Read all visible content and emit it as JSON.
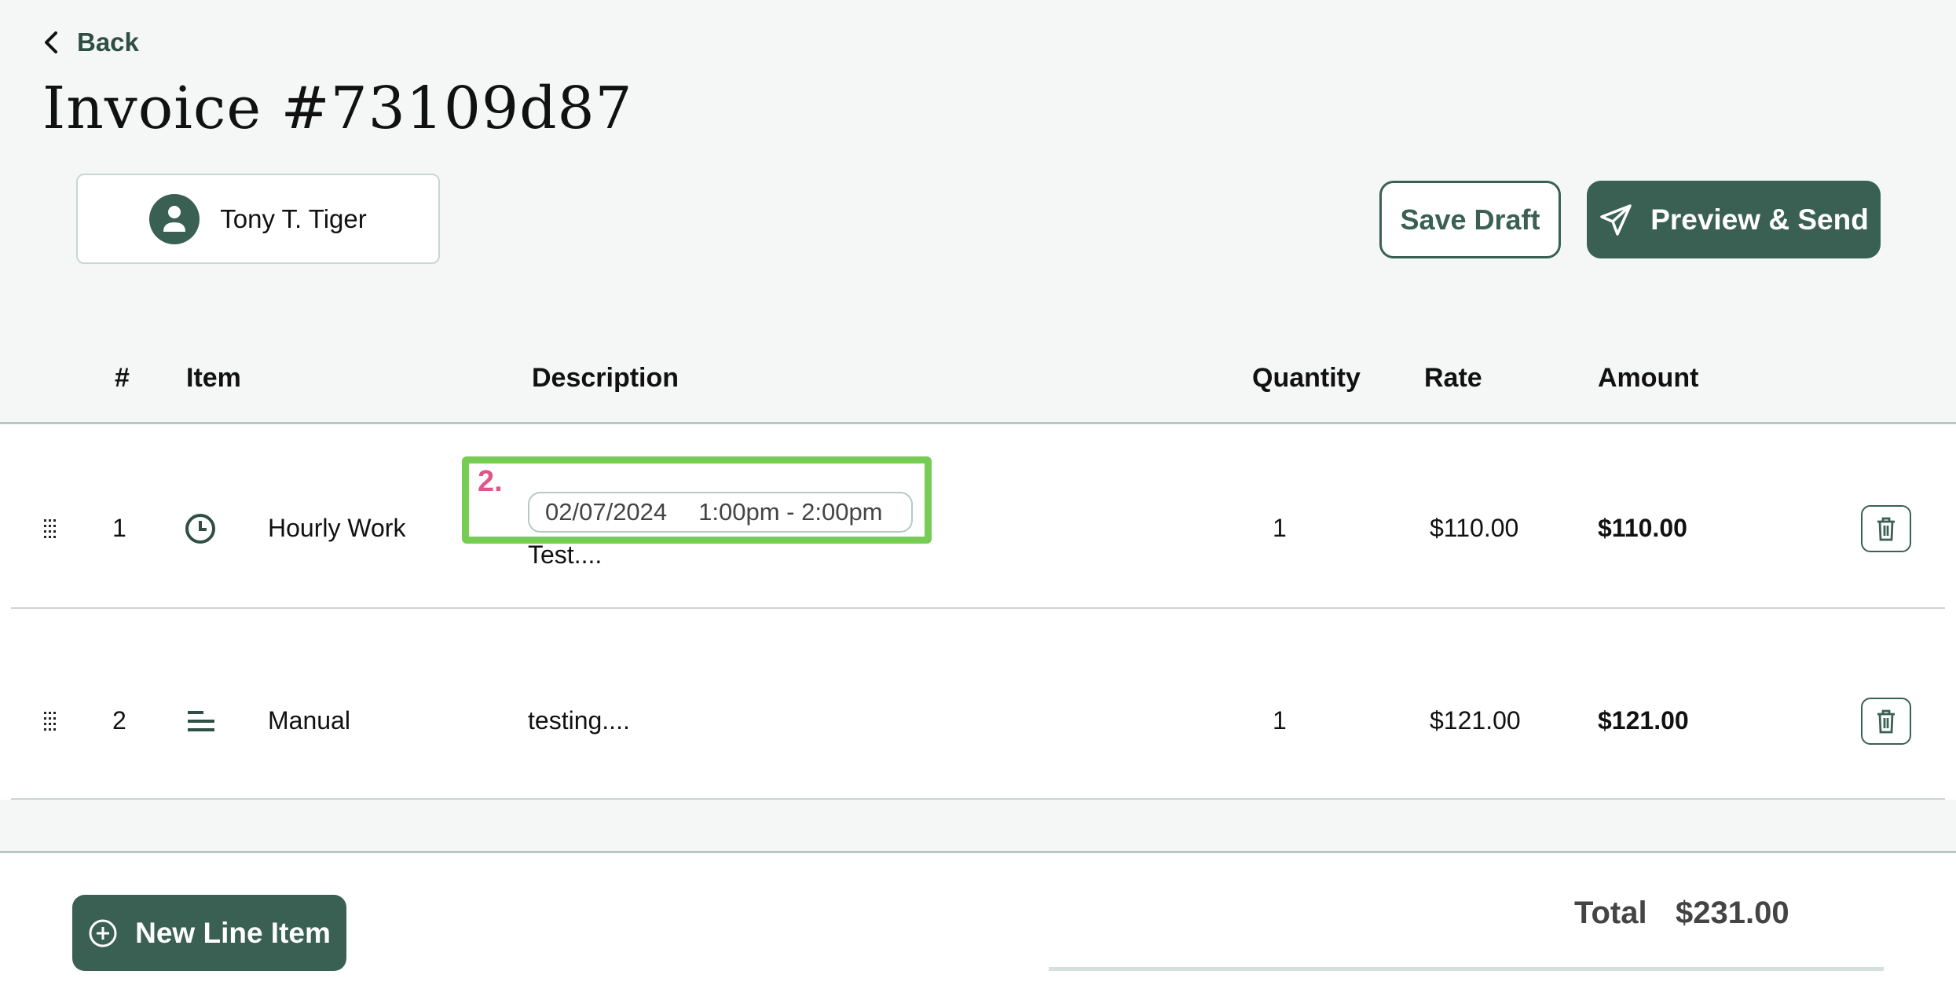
{
  "nav": {
    "back_label": "Back"
  },
  "page": {
    "title": "Invoice #73109d87"
  },
  "client": {
    "name": "Tony T. Tiger",
    "icon": "person-icon"
  },
  "actions": {
    "save_draft_label": "Save Draft",
    "preview_send_label": "Preview & Send",
    "preview_send_icon": "send-icon"
  },
  "table": {
    "columns": [
      "#",
      "Item",
      "Description",
      "Quantity",
      "Rate",
      "Amount"
    ],
    "rows": [
      {
        "number": "1",
        "item_icon": "clock-icon",
        "item": "Hourly Work",
        "date": "02/07/2024",
        "time_range": "1:00pm - 2:00pm",
        "description": "Test....",
        "quantity": "1",
        "rate": "$110.00",
        "amount": "$110.00"
      },
      {
        "number": "2",
        "item_icon": "lines-icon",
        "item": "Manual",
        "description": "testing....",
        "quantity": "1",
        "rate": "$121.00",
        "amount": "$121.00"
      }
    ]
  },
  "annotation": {
    "label": "2.",
    "color": "#77cc55"
  },
  "footer": {
    "new_line_item_label": "New Line Item",
    "total_label": "Total",
    "total_value": "$231.00"
  },
  "colors": {
    "brand": "#3a6054",
    "background": "#f5f7f6",
    "annotation_label": "#e0558a"
  }
}
